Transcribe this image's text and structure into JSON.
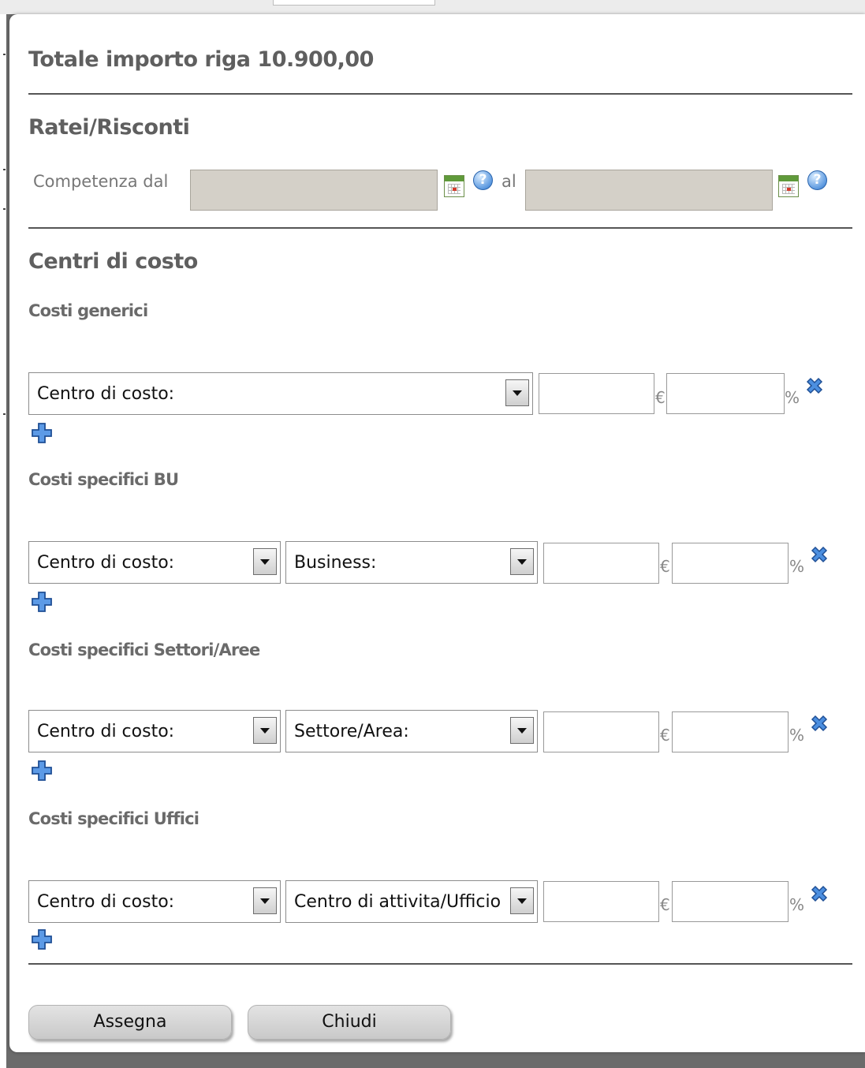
{
  "panel": {
    "title": "Totale importo riga 10.900,00"
  },
  "ratei": {
    "heading": "Ratei/Risconti",
    "from_label": "Competenza dal",
    "to_label": "al",
    "from_value": "",
    "to_value": "",
    "help_glyph": "?"
  },
  "centri": {
    "heading": "Centri di costo",
    "generici": {
      "heading": "Costi generici",
      "centro_select": "Centro di costo:",
      "amount_value": "",
      "percent_value": "",
      "currency_unit": "€",
      "percent_unit": "%"
    },
    "bu": {
      "heading": "Costi specifici BU",
      "centro_select": "Centro di costo:",
      "second_select": "Business:",
      "amount_value": "",
      "percent_value": "",
      "currency_unit": "€",
      "percent_unit": "%"
    },
    "settori": {
      "heading": "Costi specifici Settori/Aree",
      "centro_select": "Centro di costo:",
      "second_select": "Settore/Area:",
      "amount_value": "",
      "percent_value": "",
      "currency_unit": "€",
      "percent_unit": "%"
    },
    "uffici": {
      "heading": "Costi specifici Uffici",
      "centro_select": "Centro di costo:",
      "second_select": "Centro di attivita/Ufficio",
      "amount_value": "",
      "percent_value": "",
      "currency_unit": "€",
      "percent_unit": "%"
    }
  },
  "footer": {
    "assign_label": "Assegna",
    "close_label": "Chiudi"
  },
  "colors": {
    "heading": "#5f5f5f",
    "date_field_bg": "#d4d0c8",
    "icon_blue": "#2f6fc0"
  }
}
